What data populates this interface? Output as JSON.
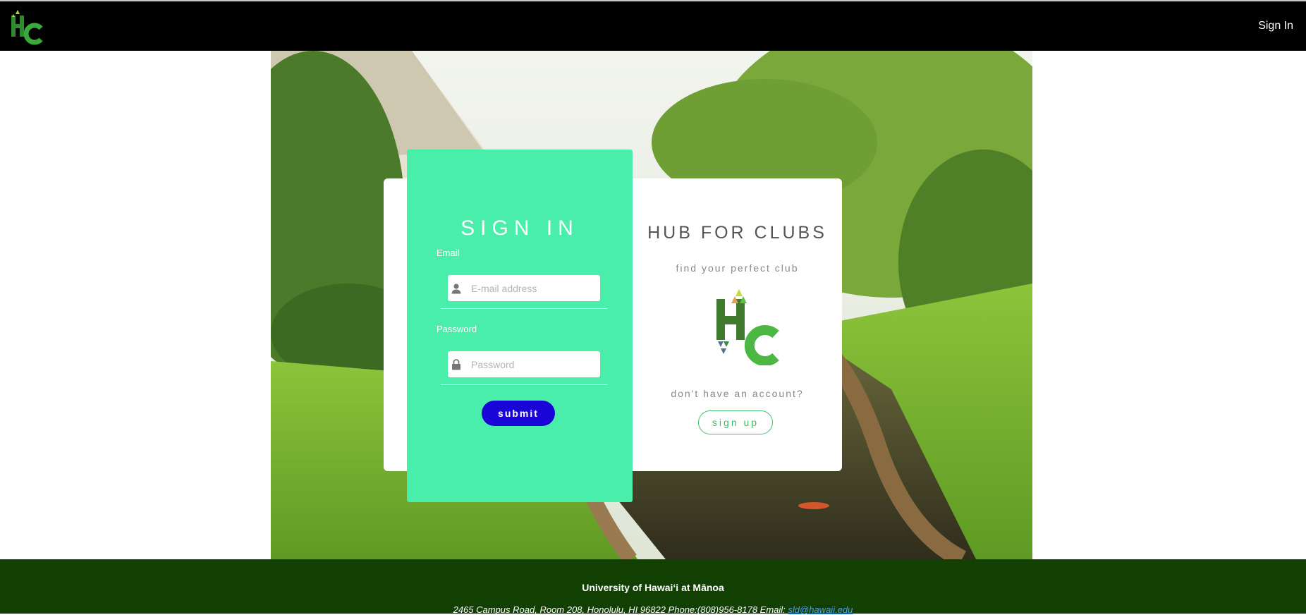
{
  "navbar": {
    "logo_letters": "HC",
    "signin_label": "Sign In"
  },
  "signin_card": {
    "title": "SIGN IN",
    "email_label": "Email",
    "email_placeholder": "E-mail address",
    "email_value": "",
    "password_label": "Password",
    "password_placeholder": "Password",
    "password_value": "",
    "submit_label": "submit"
  },
  "hub_card": {
    "title": "HUB FOR CLUBS",
    "subtitle": "find your perfect club",
    "logo_letters": "HC",
    "no_account_text": "don't have an account?",
    "signup_label": "sign up"
  },
  "footer": {
    "title": "University of Hawaiʻi at Mānoa",
    "address": "2465 Campus Road, Room 208, Honolulu, HI 96822 Phone:(808)956-8178   Email: ",
    "email": "sld@hawaii.edu"
  },
  "colors": {
    "navbar_bg": "#000000",
    "signin_card_bg": "#4aeeab",
    "submit_bg": "#1a05d8",
    "signup_accent": "#3fbf6a",
    "footer_bg": "#123f02",
    "logo_green": "#3aa83a"
  },
  "icons": {
    "email_field": "user-icon",
    "password_field": "lock-icon"
  }
}
